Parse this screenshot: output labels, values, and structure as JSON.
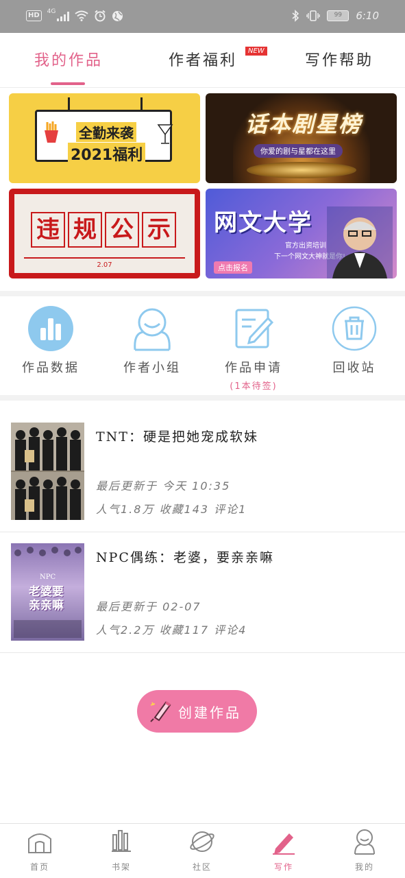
{
  "status_bar": {
    "left_badge": "HD",
    "network": "4G",
    "battery": "99",
    "time": "6:10"
  },
  "tabs": [
    {
      "label": "我的作品",
      "active": true
    },
    {
      "label": "作者福利",
      "active": false,
      "badge": "NEW"
    },
    {
      "label": "写作帮助",
      "active": false
    }
  ],
  "banners": {
    "b1": {
      "line1": "全勤来袭",
      "line2": "2021福利"
    },
    "b2": {
      "title": "话本剧星榜",
      "subtitle": "你爱的剧与星都在这里"
    },
    "b3": {
      "chars": [
        "违",
        "规",
        "公",
        "示"
      ],
      "date": "2.07"
    },
    "b4": {
      "title": "网文大学",
      "sub1": "官方出资培训",
      "sub2": "下一个网文大神就是你!",
      "button": "点击报名"
    }
  },
  "features": [
    {
      "label": "作品数据",
      "icon": "bar-chart-icon"
    },
    {
      "label": "作者小组",
      "icon": "group-icon"
    },
    {
      "label": "作品申请",
      "icon": "edit-doc-icon",
      "sub": "(1本待签)"
    },
    {
      "label": "回收站",
      "icon": "trash-icon"
    }
  ],
  "works": [
    {
      "title": "TNT：硬是把她宠成软妹",
      "updated": "最后更新于 今天 10:35",
      "stats": "人气1.8万 收藏143 评论1"
    },
    {
      "title": "NPC偶练：老婆，要亲亲嘛",
      "updated": "最后更新于 02-07",
      "stats": "人气2.2万 收藏117 评论4",
      "cover_text": [
        "NPC",
        "老婆要",
        "亲亲嘛"
      ]
    }
  ],
  "create_button": {
    "label": "创建作品"
  },
  "bottom_nav": [
    {
      "label": "首页",
      "icon": "home-icon"
    },
    {
      "label": "书架",
      "icon": "bookshelf-icon"
    },
    {
      "label": "社区",
      "icon": "planet-icon"
    },
    {
      "label": "写作",
      "icon": "pen-icon",
      "active": true
    },
    {
      "label": "我的",
      "icon": "profile-icon"
    }
  ],
  "colors": {
    "accent": "#e2628a",
    "button": "#f07aa6",
    "icon_blue": "#8ec9ee"
  }
}
